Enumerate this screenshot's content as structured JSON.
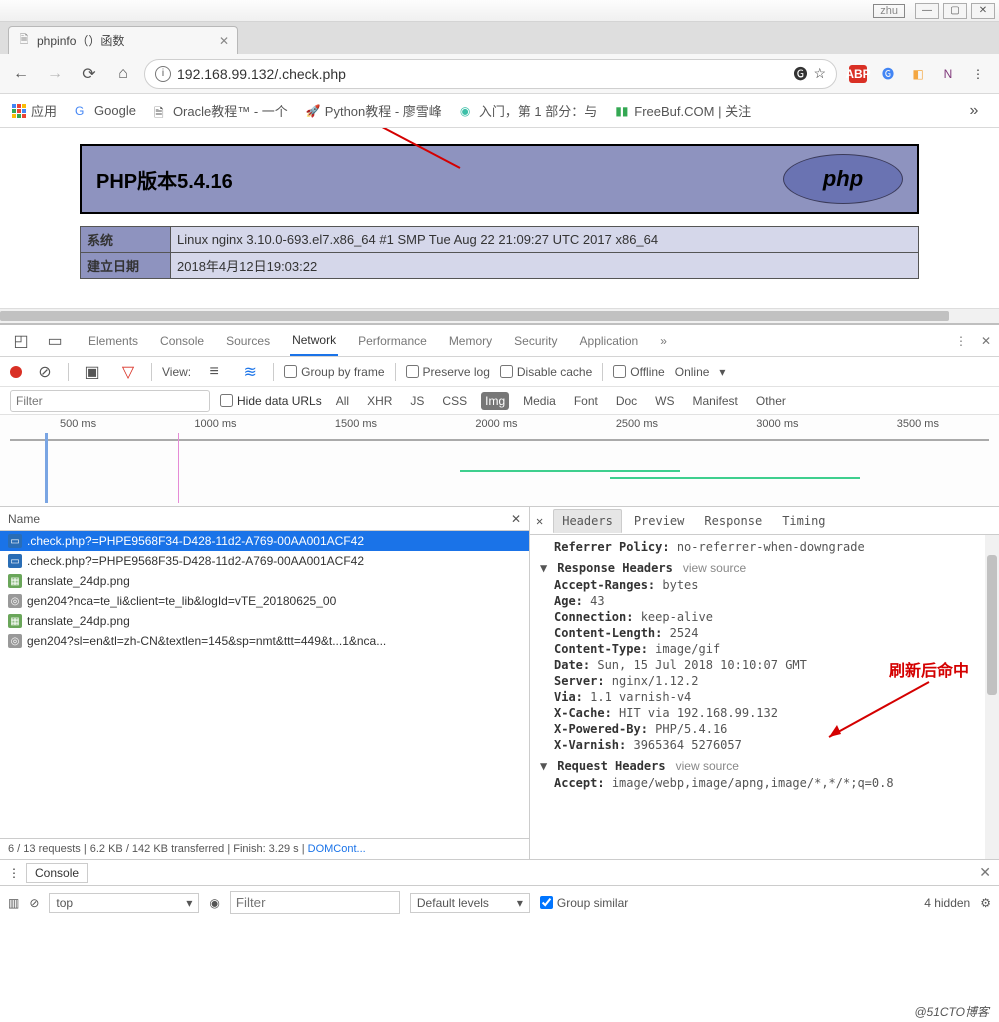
{
  "window": {
    "user": "zhu"
  },
  "tab": {
    "title": "phpinfo（）函数"
  },
  "nav": {
    "url": "192.168.99.132/.check.php"
  },
  "bookmarks": {
    "apps": "应用",
    "items": [
      {
        "label": "Google"
      },
      {
        "label": "Oracle教程™ - 一个"
      },
      {
        "label": "Python教程 - 廖雪峰"
      },
      {
        "label": "入门，第 1 部分：与"
      },
      {
        "label": "FreeBuf.COM | 关注"
      }
    ]
  },
  "page": {
    "php_banner": "PHP版本5.4.16",
    "php_logo": "php",
    "row1_k": "系统",
    "row1_v": "Linux nginx 3.10.0-693.el7.x86_64 #1 SMP Tue Aug 22 21:09:27 UTC 2017 x86_64",
    "row2_k": "建立日期",
    "row2_v": "2018年4月12日19:03:22"
  },
  "devtools": {
    "tabs": [
      "Elements",
      "Console",
      "Sources",
      "Network",
      "Performance",
      "Memory",
      "Security",
      "Application"
    ],
    "active_tab": 3,
    "toolbar": {
      "view": "View:",
      "group": "Group by frame",
      "preserve": "Preserve log",
      "disable_cache": "Disable cache",
      "offline": "Offline",
      "online": "Online"
    },
    "filter": {
      "placeholder": "Filter",
      "hide_urls": "Hide data URLs",
      "types": [
        "All",
        "XHR",
        "JS",
        "CSS",
        "Img",
        "Media",
        "Font",
        "Doc",
        "WS",
        "Manifest",
        "Other"
      ],
      "active_type": 4
    },
    "timeline_ticks": [
      "500 ms",
      "1000 ms",
      "1500 ms",
      "2000 ms",
      "2500 ms",
      "3000 ms",
      "3500 ms"
    ],
    "name_header": "Name",
    "requests": [
      {
        "name": ".check.php?=PHPE9568F34-D428-11d2-A769-00AA001ACF42",
        "type": "php",
        "selected": true
      },
      {
        "name": ".check.php?=PHPE9568F35-D428-11d2-A769-00AA001ACF42",
        "type": "php"
      },
      {
        "name": "translate_24dp.png",
        "type": "img"
      },
      {
        "name": "gen204?nca=te_li&client=te_lib&logId=vTE_20180625_00",
        "type": "txt"
      },
      {
        "name": "translate_24dp.png",
        "type": "img"
      },
      {
        "name": "gen204?sl=en&tl=zh-CN&textlen=145&sp=nmt&ttt=449&t...1&nca...",
        "type": "txt"
      }
    ],
    "status": {
      "summary": "6 / 13 requests  |  6.2 KB / 142 KB transferred  |  Finish: 3.29 s  |  ",
      "domcontent": "DOMCont..."
    },
    "detail": {
      "tabs": [
        "Headers",
        "Preview",
        "Response",
        "Timing"
      ],
      "active": 0,
      "referrer_k": "Referrer Policy:",
      "referrer_v": "no-referrer-when-downgrade",
      "response_section": "Response Headers",
      "view_source": "view source",
      "headers": [
        {
          "k": "Accept-Ranges:",
          "v": "bytes"
        },
        {
          "k": "Age:",
          "v": "43"
        },
        {
          "k": "Connection:",
          "v": "keep-alive"
        },
        {
          "k": "Content-Length:",
          "v": "2524"
        },
        {
          "k": "Content-Type:",
          "v": "image/gif"
        },
        {
          "k": "Date:",
          "v": "Sun, 15 Jul 2018 10:10:07 GMT"
        },
        {
          "k": "Server:",
          "v": "nginx/1.12.2"
        },
        {
          "k": "Via:",
          "v": "1.1 varnish-v4"
        },
        {
          "k": "X-Cache:",
          "v": "HIT via 192.168.99.132"
        },
        {
          "k": "X-Powered-By:",
          "v": "PHP/5.4.16"
        },
        {
          "k": "X-Varnish:",
          "v": "3965364 5276057"
        }
      ],
      "request_section": "Request Headers",
      "accept_k": "Accept:",
      "accept_v": "image/webp,image/apng,image/*,*/*;q=0.8"
    }
  },
  "annotation": "刷新后命中",
  "drawer": {
    "console": "Console",
    "context": "top",
    "filter_placeholder": "Filter",
    "levels": "Default levels",
    "group": "Group similar",
    "hidden": "4 hidden"
  },
  "footer": "@51CTO博客"
}
